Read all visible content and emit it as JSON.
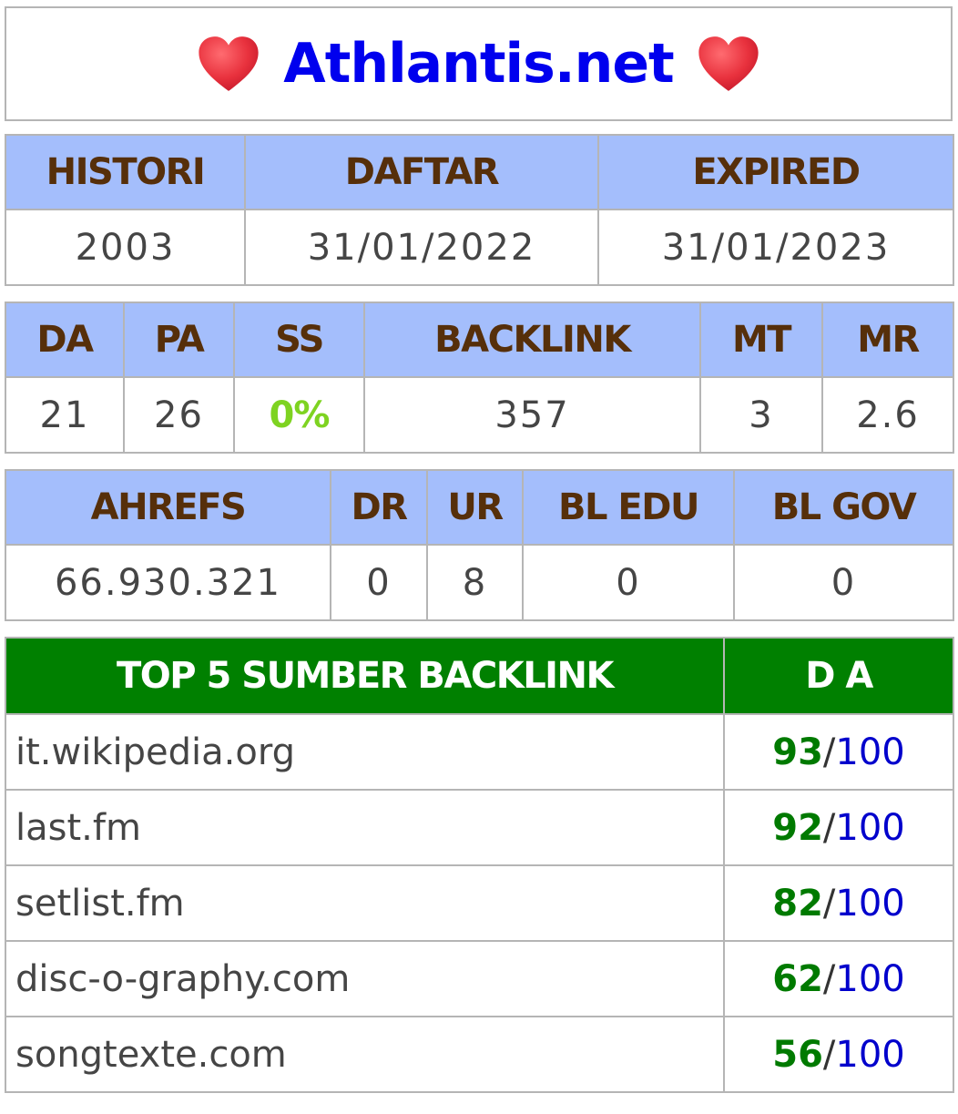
{
  "header": {
    "site_title": "Athlantis.net",
    "heart_icon_color": "#e8313d"
  },
  "domain_info": {
    "headers": [
      "HISTORI",
      "DAFTAR",
      "EXPIRED"
    ],
    "values": [
      "2003",
      "31/01/2022",
      "31/01/2023"
    ]
  },
  "moz_metrics": {
    "headers": [
      "DA",
      "PA",
      "SS",
      "BACKLINK",
      "MT",
      "MR"
    ],
    "values": [
      "21",
      "26",
      "0%",
      "357",
      "3",
      "2.6"
    ]
  },
  "ahrefs_metrics": {
    "headers": [
      "AHREFS",
      "DR",
      "UR",
      "BL EDU",
      "BL GOV"
    ],
    "values": [
      "66.930.321",
      "0",
      "8",
      "0",
      "0"
    ]
  },
  "top_backlinks": {
    "header_source": "TOP 5 SUMBER BACKLINK",
    "header_da": "D A",
    "separator": "/",
    "max": "100",
    "rows": [
      {
        "domain": "it.wikipedia.org",
        "da": "93"
      },
      {
        "domain": "last.fm",
        "da": "92"
      },
      {
        "domain": "setlist.fm",
        "da": "82"
      },
      {
        "domain": "disc-o-graphy.com",
        "da": "62"
      },
      {
        "domain": "songtexte.com",
        "da": "56"
      }
    ]
  },
  "colors": {
    "header_bg": "#a4befc",
    "header_text": "#562f0a",
    "top_header_bg": "#008000",
    "ss_value": "#7ed321",
    "da_value": "#007a00",
    "da_max": "#0000cc",
    "title_link": "#0000ee"
  }
}
